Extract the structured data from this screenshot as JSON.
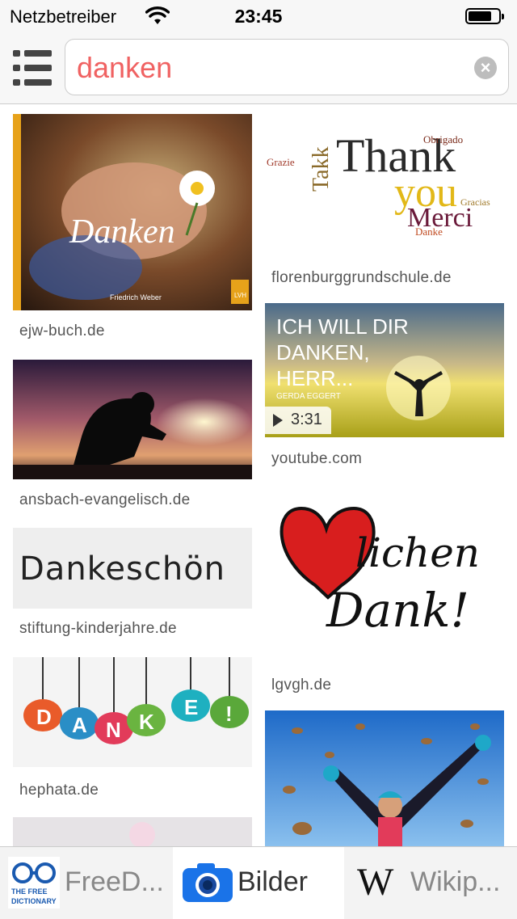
{
  "status": {
    "carrier": "Netzbetreiber",
    "time": "23:45"
  },
  "search": {
    "query": "danken"
  },
  "results": {
    "left": [
      {
        "caption": "ejw-buch.de",
        "title": "Danken",
        "author": "Friedrich Weber",
        "publisher": "LVH"
      },
      {
        "caption": "ansbach-evangelisch.de"
      },
      {
        "caption": "stiftung-kinderjahre.de",
        "text": "Dankeschön"
      },
      {
        "caption": "hephata.de",
        "letters": [
          "D",
          "A",
          "N",
          "K",
          "E",
          "!"
        ]
      }
    ],
    "right": [
      {
        "caption": "florenburggrundschule.de",
        "words": [
          "Thank",
          "you",
          "Merci",
          "Takk",
          "Danke",
          "Grazie",
          "Obrigado",
          "Gracias"
        ]
      },
      {
        "caption": "youtube.com",
        "text_lines": [
          "ICH WILL DIR",
          "DANKEN,",
          "HERR..."
        ],
        "artist": "GERDA EGGERT",
        "duration": "3:31"
      },
      {
        "caption": "lgvgh.de",
        "text_top": "lichen",
        "text_bottom": "Dank!"
      },
      {
        "caption": ""
      }
    ]
  },
  "tabs": [
    {
      "label": "FreeD...",
      "icon": "free-dictionary-icon",
      "active": false
    },
    {
      "label": "Bilder",
      "icon": "camera-icon",
      "active": true
    },
    {
      "label": "Wikip...",
      "icon": "wikipedia-icon",
      "active": false
    }
  ],
  "colors": {
    "query": "#f06262",
    "active_tab": "#ffffff",
    "camera": "#1a73e8"
  }
}
